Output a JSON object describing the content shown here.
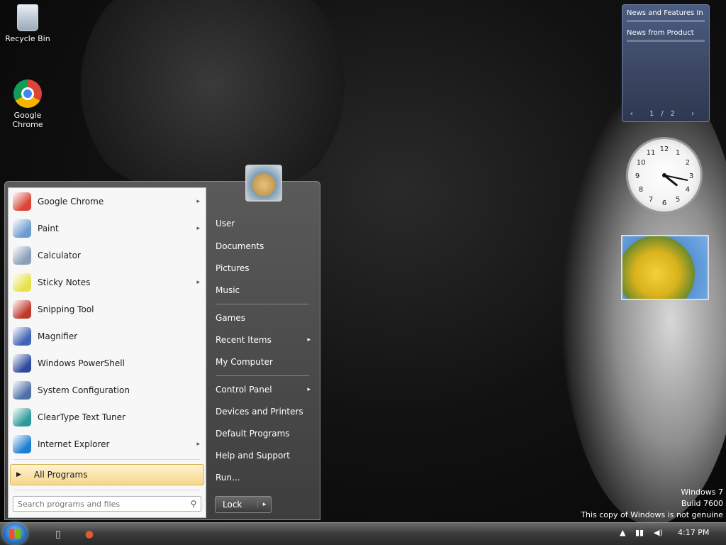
{
  "desktop": {
    "icons": [
      {
        "name": "recycle-bin",
        "label": "Recycle Bin"
      },
      {
        "name": "google-chrome",
        "label": "Google Chrome"
      }
    ],
    "watermark": {
      "line1": "Windows 7",
      "line2": "Build 7600",
      "line3": "This copy of Windows is not genuine"
    }
  },
  "gadgets": {
    "feed": {
      "headline1": "News and Features In",
      "headline2": "News from Product",
      "nav": "‹ 1/2 ›"
    },
    "clock": {
      "hour": 4,
      "minute": 17
    },
    "slideshow": {
      "caption": ""
    }
  },
  "start_menu": {
    "programs": [
      {
        "label": "Google Chrome",
        "icon": "chrome-icon",
        "color": "#db4437",
        "submenu": true
      },
      {
        "label": "Paint",
        "icon": "paint-icon",
        "color": "#6d9bd1",
        "submenu": true
      },
      {
        "label": "Calculator",
        "icon": "calculator-icon",
        "color": "#8a9fb8",
        "submenu": false
      },
      {
        "label": "Sticky Notes",
        "icon": "sticky-notes-icon",
        "color": "#e6e24b",
        "submenu": true
      },
      {
        "label": "Snipping Tool",
        "icon": "snipping-tool-icon",
        "color": "#c0392b",
        "submenu": false
      },
      {
        "label": "Magnifier",
        "icon": "magnifier-icon",
        "color": "#3e63b8",
        "submenu": false
      },
      {
        "label": "Windows PowerShell",
        "icon": "powershell-icon",
        "color": "#2d4a9e",
        "submenu": false
      },
      {
        "label": "System Configuration",
        "icon": "system-config-icon",
        "color": "#4f6fa8",
        "submenu": false
      },
      {
        "label": "ClearType Text Tuner",
        "icon": "cleartype-icon",
        "color": "#2e9a9a",
        "submenu": false
      },
      {
        "label": "Internet Explorer",
        "icon": "internet-explorer-icon",
        "color": "#1e7fd0",
        "submenu": true
      }
    ],
    "all_programs": "All Programs",
    "search_placeholder": "Search programs and files",
    "right_items": [
      {
        "label": "User",
        "submenu": false
      },
      {
        "label": "Documents",
        "submenu": false
      },
      {
        "label": "Pictures",
        "submenu": false
      },
      {
        "label": "Music",
        "submenu": false
      },
      {
        "label": "Games",
        "submenu": false
      },
      {
        "label": "Recent Items",
        "submenu": true
      },
      {
        "label": "My Computer",
        "submenu": false
      },
      {
        "label": "Control Panel",
        "submenu": true
      },
      {
        "label": "Devices and Printers",
        "submenu": false
      },
      {
        "label": "Default Programs",
        "submenu": false
      },
      {
        "label": "Help and Support",
        "submenu": false
      },
      {
        "label": "Run...",
        "submenu": false
      }
    ],
    "shutdown_label": "Lock",
    "shutdown_arrow": "▸"
  },
  "taskbar": {
    "pinned": [
      {
        "name": "windows-explorer-icon",
        "glyph": "▯"
      },
      {
        "name": "firefox-icon",
        "glyph": "●"
      }
    ],
    "tray_clock": "4:17 PM"
  }
}
